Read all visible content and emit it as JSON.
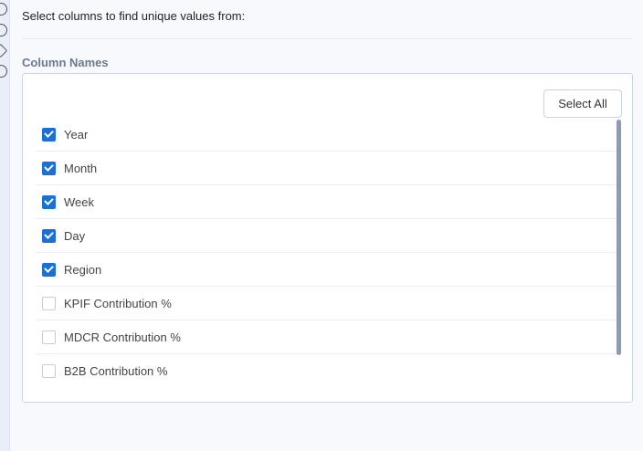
{
  "sidebar": {
    "icons": [
      "gear-icon",
      "eye-icon",
      "diamond-icon",
      "eye-icon"
    ]
  },
  "intro": "Select columns to find unique values from:",
  "column_names_label": "Column Names",
  "select_all_label": "Select All",
  "columns": [
    {
      "label": "Year",
      "checked": true
    },
    {
      "label": "Month",
      "checked": true
    },
    {
      "label": "Week",
      "checked": true
    },
    {
      "label": "Day",
      "checked": true
    },
    {
      "label": "Region",
      "checked": true
    },
    {
      "label": "KPIF Contribution %",
      "checked": false
    },
    {
      "label": "MDCR Contribution %",
      "checked": false
    },
    {
      "label": "B2B Contribution %",
      "checked": false
    }
  ]
}
